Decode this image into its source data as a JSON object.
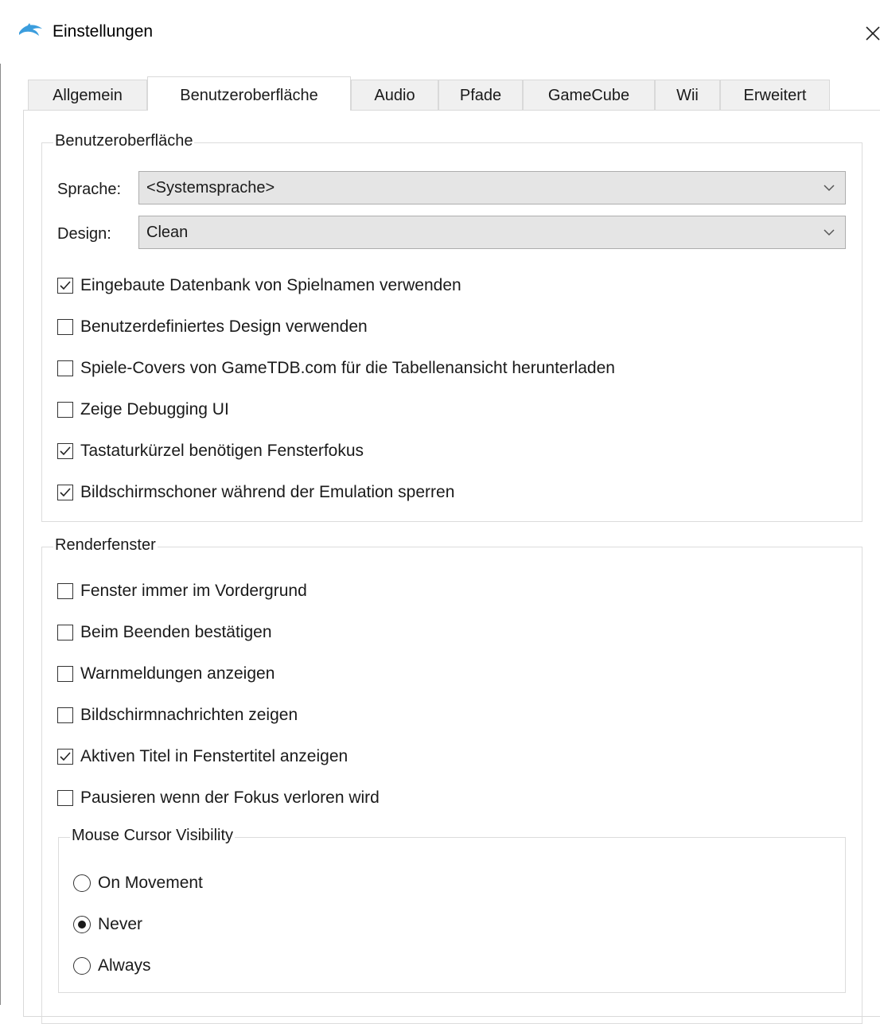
{
  "window": {
    "title": "Einstellungen",
    "close_glyph": "×"
  },
  "tabs": [
    {
      "label": "Allgemein",
      "active": false
    },
    {
      "label": "Benutzeroberfläche",
      "active": true
    },
    {
      "label": "Audio",
      "active": false
    },
    {
      "label": "Pfade",
      "active": false
    },
    {
      "label": "GameCube",
      "active": false
    },
    {
      "label": "Wii",
      "active": false
    },
    {
      "label": "Erweitert",
      "active": false
    }
  ],
  "ui_group": {
    "title": "Benutzeroberfläche",
    "language_label": "Sprache:",
    "language_value": "<Systemsprache>",
    "design_label": "Design:",
    "design_value": "Clean",
    "checkboxes": [
      {
        "label": "Eingebaute Datenbank von Spielnamen verwenden",
        "checked": true
      },
      {
        "label": "Benutzerdefiniertes Design verwenden",
        "checked": false
      },
      {
        "label": "Spiele-Covers von GameTDB.com für die Tabellenansicht herunterladen",
        "checked": false
      },
      {
        "label": "Zeige Debugging UI",
        "checked": false
      },
      {
        "label": "Tastaturkürzel benötigen Fensterfokus",
        "checked": true
      },
      {
        "label": "Bildschirmschoner während der Emulation sperren",
        "checked": true
      }
    ]
  },
  "render_group": {
    "title": "Renderfenster",
    "checkboxes": [
      {
        "label": "Fenster immer im Vordergrund",
        "checked": false
      },
      {
        "label": "Beim Beenden bestätigen",
        "checked": false
      },
      {
        "label": "Warnmeldungen anzeigen",
        "checked": false
      },
      {
        "label": "Bildschirmnachrichten zeigen",
        "checked": false
      },
      {
        "label": "Aktiven Titel in Fenstertitel anzeigen",
        "checked": true
      },
      {
        "label": "Pausieren wenn der Fokus verloren wird",
        "checked": false
      }
    ],
    "cursor_group": {
      "title": "Mouse Cursor Visibility",
      "options": [
        {
          "label": "On Movement",
          "selected": false
        },
        {
          "label": "Never",
          "selected": true
        },
        {
          "label": "Always",
          "selected": false
        }
      ]
    }
  },
  "colors": {
    "accent_icon": "#3b9ddd",
    "tab_inactive": "#f0f0f0",
    "combo_bg": "#e5e5e5"
  }
}
